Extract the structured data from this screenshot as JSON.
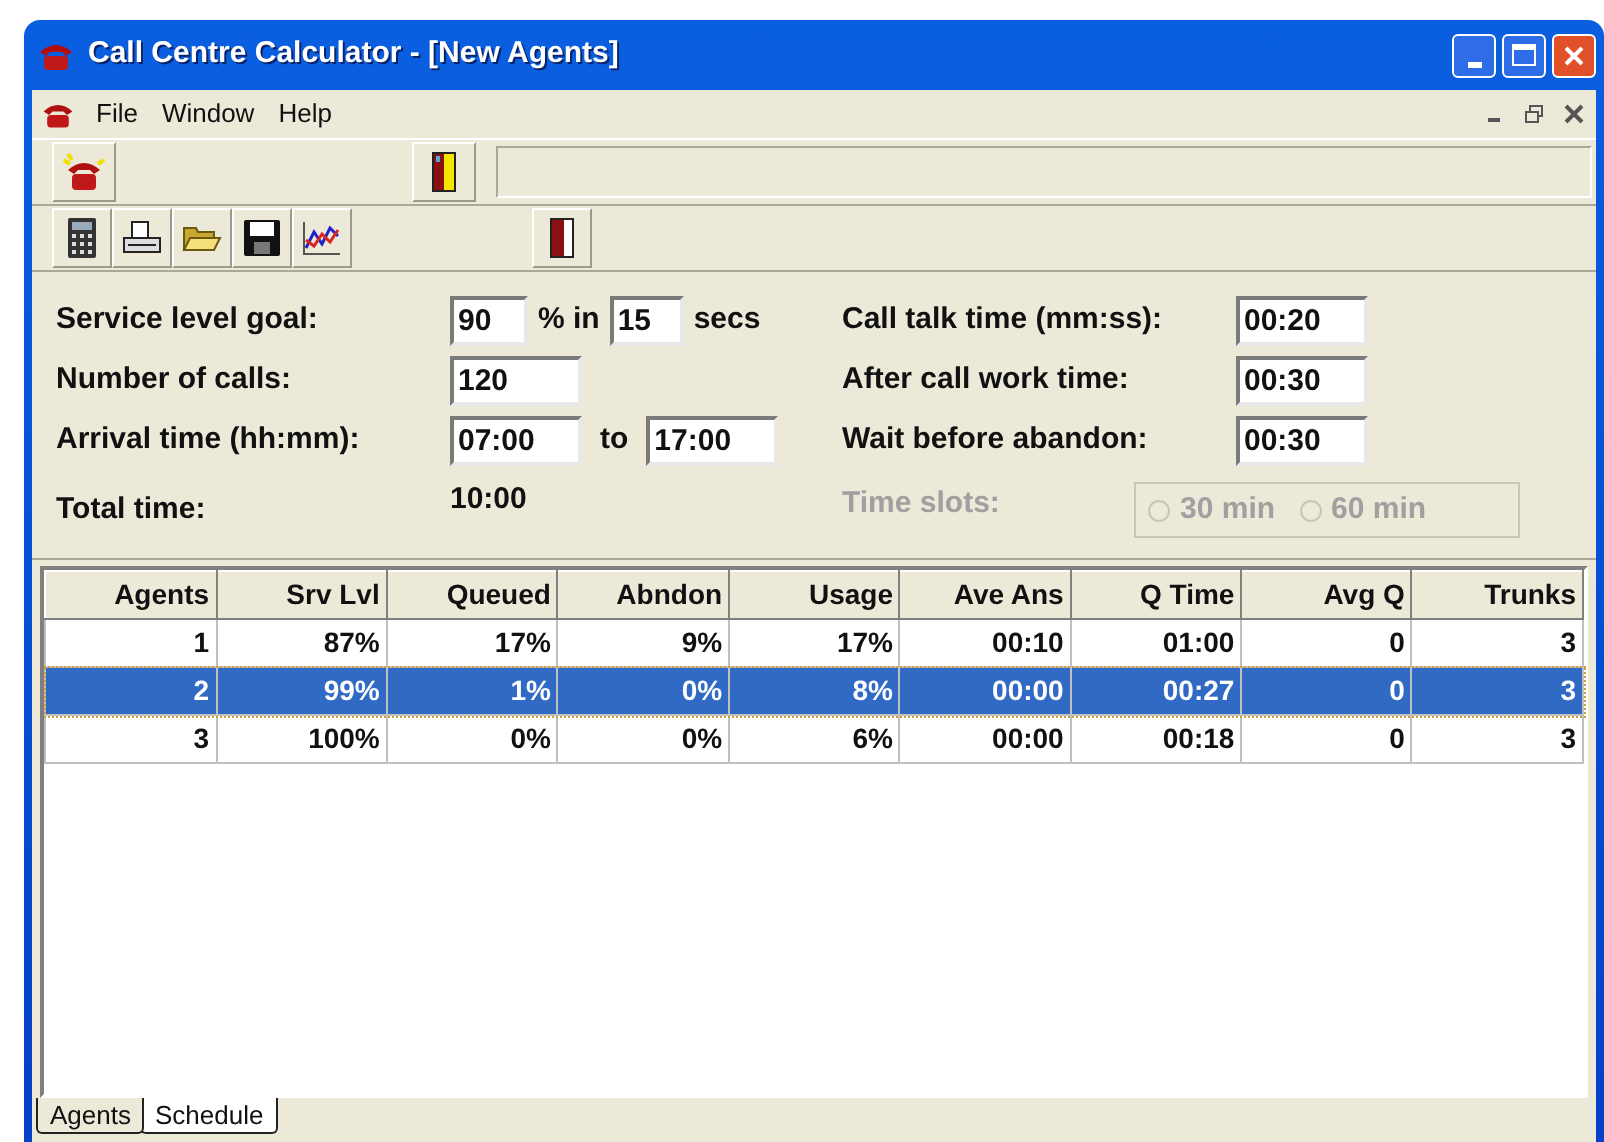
{
  "window": {
    "title": "Call Centre Calculator - [New Agents]"
  },
  "menu": [
    "File",
    "Window",
    "Help"
  ],
  "form": {
    "left": [
      {
        "kind": "goal",
        "label": "Service level goal:",
        "value": "90",
        "mid": "% in",
        "value2": "15",
        "unit": "secs"
      },
      {
        "kind": "single",
        "label": "Number of calls:",
        "value": "120"
      },
      {
        "kind": "range",
        "label": "Arrival time (hh:mm):",
        "value": "07:00",
        "mid": "to",
        "value2": "17:00"
      },
      {
        "kind": "readout",
        "label": "Total time:",
        "value": "10:00"
      }
    ],
    "right": [
      {
        "label": "Call talk time (mm:ss):",
        "value": "00:20"
      },
      {
        "label": "After call work time:",
        "value": "00:30"
      },
      {
        "label": "Wait before abandon:",
        "value": "00:30"
      }
    ],
    "time_slots": {
      "label": "Time slots:",
      "disabled": true,
      "options": [
        {
          "label": "30 min",
          "selected": false
        },
        {
          "label": "60 min",
          "selected": false
        }
      ]
    }
  },
  "table": {
    "columns": [
      "Agents",
      "Srv Lvl",
      "Queued",
      "Abndon",
      "Usage",
      "Ave Ans",
      "Q Time",
      "Avg Q",
      "Trunks"
    ],
    "rows": [
      {
        "cells": [
          "1",
          "87%",
          "17%",
          "9%",
          "17%",
          "00:10",
          "01:00",
          "0",
          "3"
        ],
        "selected": false
      },
      {
        "cells": [
          "2",
          "99%",
          "1%",
          "0%",
          "8%",
          "00:00",
          "00:27",
          "0",
          "3"
        ],
        "selected": true
      },
      {
        "cells": [
          "3",
          "100%",
          "0%",
          "0%",
          "6%",
          "00:00",
          "00:18",
          "0",
          "3"
        ],
        "selected": false
      }
    ]
  },
  "tabs": [
    {
      "label": "Agents",
      "selected": true
    },
    {
      "label": "Schedule",
      "selected": false
    }
  ]
}
